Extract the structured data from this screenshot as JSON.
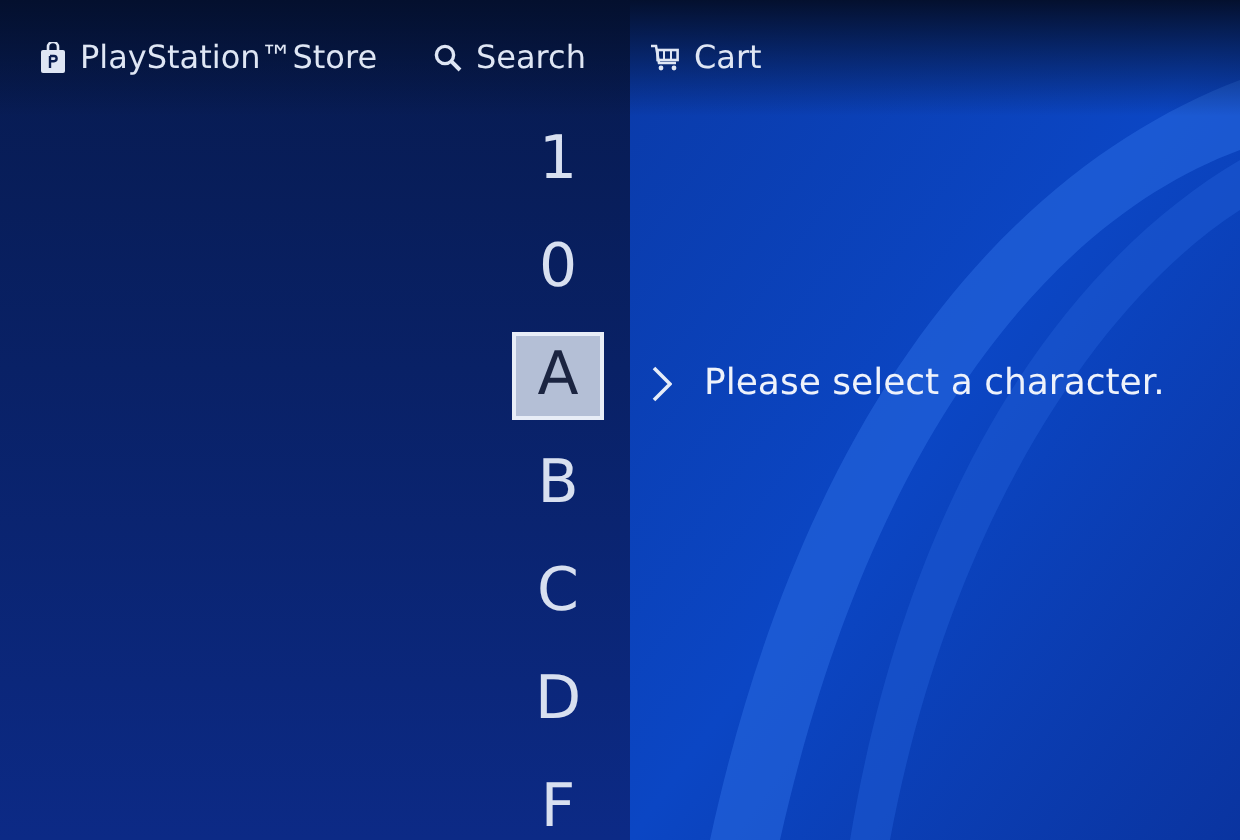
{
  "nav": [
    {
      "kind": "store",
      "label": "PlayStation™Store"
    },
    {
      "kind": "search",
      "label": "Search"
    },
    {
      "kind": "cart",
      "label": "Cart"
    }
  ],
  "characters": [
    {
      "label": "1",
      "selected": false
    },
    {
      "label": "0",
      "selected": false
    },
    {
      "label": "A",
      "selected": true
    },
    {
      "label": "B",
      "selected": false
    },
    {
      "label": "C",
      "selected": false
    },
    {
      "label": "D",
      "selected": false
    },
    {
      "label": "F",
      "selected": false
    }
  ],
  "prompt": "Please select a character."
}
